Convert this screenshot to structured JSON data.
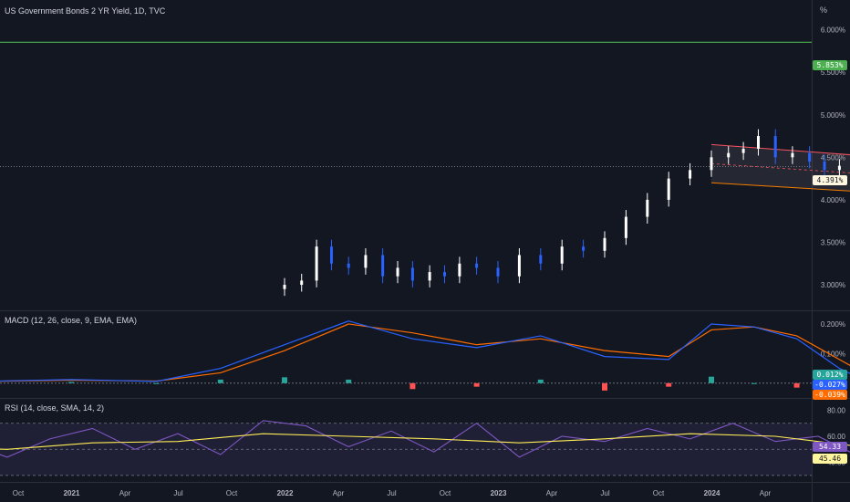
{
  "chart_data": [
    {
      "type": "candlestick",
      "title": "US Government Bonds 2 YR Yield, 1D, TVC",
      "unit_label": "%",
      "y_ticks": [
        "3.000%",
        "3.500%",
        "4.000%",
        "4.500%",
        "5.000%",
        "5.500%",
        "6.000%"
      ],
      "ylim": [
        2.7,
        6.35
      ],
      "x_ticks": [
        "Oct",
        "2021",
        "Apr",
        "Jul",
        "Oct",
        "2022",
        "Apr",
        "Jul",
        "Oct",
        "2023",
        "Apr",
        "Jul",
        "Oct",
        "2024",
        "Apr"
      ],
      "last_value_label": "4.391%",
      "target_label": "5.853%",
      "target_value": 5.853,
      "current_value": 4.391,
      "grid": false,
      "series": [
        {
          "x": [
            0.0,
            0.08,
            0.15,
            0.22,
            0.3,
            0.38,
            0.46,
            0.53,
            0.6,
            0.68,
            0.75,
            0.82,
            0.9,
            1.0,
            1.1,
            1.2,
            1.3,
            1.4,
            1.5,
            1.6,
            1.7,
            1.8,
            1.9,
            2.0,
            2.08,
            2.15,
            2.22,
            2.3,
            2.38,
            2.46,
            2.53,
            2.6,
            2.67,
            2.72,
            2.78,
            2.84,
            2.9,
            2.95
          ],
          "y": [
            3.0,
            3.05,
            3.45,
            3.25,
            3.2,
            3.35,
            3.1,
            3.2,
            3.05,
            3.15,
            3.1,
            3.25,
            3.2,
            3.1,
            3.35,
            3.25,
            3.45,
            3.4,
            3.55,
            3.8,
            4.0,
            4.25,
            4.35,
            4.5,
            4.55,
            4.6,
            4.75,
            4.5,
            4.55,
            4.45,
            4.35,
            4.4,
            4.25,
            4.3,
            4.2,
            4.35,
            4.25,
            4.39
          ]
        }
      ],
      "annotations": {
        "channel_upper": [
          [
            2.0,
            4.65
          ],
          [
            3.35,
            4.4
          ]
        ],
        "channel_lower": [
          [
            2.0,
            4.2
          ],
          [
            3.35,
            4.0
          ]
        ],
        "target_line_x": 3.25
      }
    },
    {
      "type": "line",
      "title": "MACD (12, 26, close, 9, EMA, EMA)",
      "y_ticks": [
        "0.100%",
        "0.200%"
      ],
      "ylim": [
        -0.05,
        0.24
      ],
      "last_labels": [
        "0.012%",
        "-0.027%",
        "-0.039%"
      ],
      "series": [
        {
          "name": "MACD",
          "x": [
            -2.5,
            -2.0,
            -1.5,
            -1.0,
            -0.6,
            -0.3,
            0.0,
            0.3,
            0.6,
            0.9,
            1.2,
            1.5,
            1.8,
            2.0,
            2.2,
            2.4,
            2.6,
            2.8,
            3.0
          ],
          "y": [
            0.005,
            0.004,
            0.005,
            0.012,
            0.006,
            0.05,
            0.13,
            0.21,
            0.15,
            0.12,
            0.16,
            0.09,
            0.08,
            0.2,
            0.19,
            0.15,
            0.05,
            -0.02,
            -0.027
          ]
        },
        {
          "name": "Signal",
          "x": [
            -2.5,
            -2.0,
            -1.5,
            -1.0,
            -0.6,
            -0.3,
            0.0,
            0.3,
            0.6,
            0.9,
            1.2,
            1.5,
            1.8,
            2.0,
            2.2,
            2.4,
            2.6,
            2.8,
            3.0
          ],
          "y": [
            0.005,
            0.005,
            0.005,
            0.01,
            0.007,
            0.035,
            0.11,
            0.2,
            0.17,
            0.13,
            0.15,
            0.11,
            0.09,
            0.18,
            0.19,
            0.16,
            0.08,
            0.0,
            -0.039
          ]
        },
        {
          "name": "Histogram",
          "x": [
            -1.0,
            -0.6,
            -0.3,
            0.0,
            0.3,
            0.6,
            0.9,
            1.2,
            1.5,
            1.8,
            2.0,
            2.2,
            2.4,
            2.6,
            2.8,
            3.0
          ],
          "y": [
            0.004,
            0.0,
            0.012,
            0.02,
            0.012,
            -0.02,
            -0.012,
            0.012,
            -0.025,
            -0.012,
            0.022,
            0.0,
            -0.015,
            -0.03,
            -0.02,
            0.012
          ]
        }
      ]
    },
    {
      "type": "line",
      "title": "RSI (14, close, SMA, 14, 2)",
      "y_ticks": [
        "40.00",
        "60.00",
        "80.00"
      ],
      "ylim": [
        25,
        88
      ],
      "bands": [
        30,
        50,
        70
      ],
      "last_labels": [
        "54.33",
        "45.46"
      ],
      "series": [
        {
          "name": "RSI",
          "x": [
            -2.5,
            -2.3,
            -2.1,
            -1.9,
            -1.7,
            -1.5,
            -1.3,
            -1.1,
            -0.9,
            -0.7,
            -0.5,
            -0.3,
            -0.1,
            0.1,
            0.3,
            0.5,
            0.7,
            0.9,
            1.1,
            1.3,
            1.5,
            1.7,
            1.9,
            2.1,
            2.3,
            2.5,
            2.7,
            2.9,
            3.0
          ],
          "y": [
            52,
            60,
            48,
            64,
            38,
            56,
            44,
            58,
            66,
            50,
            62,
            46,
            72,
            68,
            52,
            64,
            48,
            70,
            44,
            60,
            56,
            66,
            58,
            70,
            56,
            60,
            44,
            38,
            54.33
          ]
        },
        {
          "name": "RSI-based MA",
          "x": [
            -2.5,
            -2.1,
            -1.7,
            -1.3,
            -0.9,
            -0.5,
            -0.1,
            0.3,
            0.7,
            1.1,
            1.5,
            1.9,
            2.3,
            2.7,
            3.0
          ],
          "y": [
            53,
            54,
            52,
            50,
            55,
            56,
            62,
            60,
            58,
            55,
            58,
            62,
            60,
            52,
            45.46
          ]
        }
      ]
    }
  ]
}
